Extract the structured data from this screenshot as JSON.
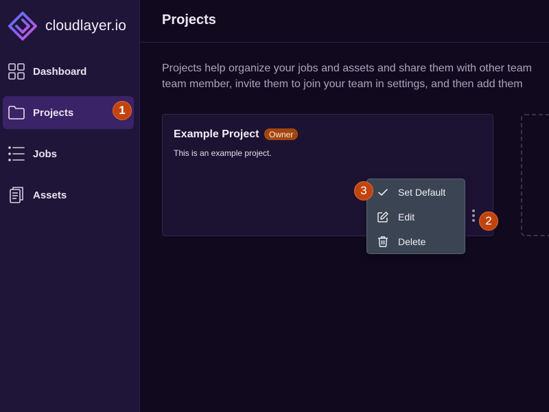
{
  "app": {
    "name": "cloudlayer.io"
  },
  "sidebar": {
    "items": [
      {
        "label": "Dashboard",
        "icon": "grid-icon"
      },
      {
        "label": "Projects",
        "icon": "folder-icon",
        "active": true
      },
      {
        "label": "Jobs",
        "icon": "list-icon"
      },
      {
        "label": "Assets",
        "icon": "document-icon"
      }
    ]
  },
  "header": {
    "title": "Projects"
  },
  "main": {
    "description_line1": "Projects help organize your jobs and assets and share them with other team",
    "description_line2": "team member, invite them to join your team in settings, and then add them"
  },
  "project_card": {
    "title": "Example Project",
    "badge": "Owner",
    "description": "This is an example project."
  },
  "context_menu": {
    "items": [
      {
        "label": "Set Default",
        "icon": "check-icon"
      },
      {
        "label": "Edit",
        "icon": "edit-icon"
      },
      {
        "label": "Delete",
        "icon": "trash-icon"
      }
    ]
  },
  "annotations": {
    "step1": "1",
    "step2": "2",
    "step3": "3"
  },
  "colors": {
    "accent": "#3a2366",
    "badge": "#c1440e",
    "background": "#110a1f",
    "sidebar": "#1f1538"
  }
}
